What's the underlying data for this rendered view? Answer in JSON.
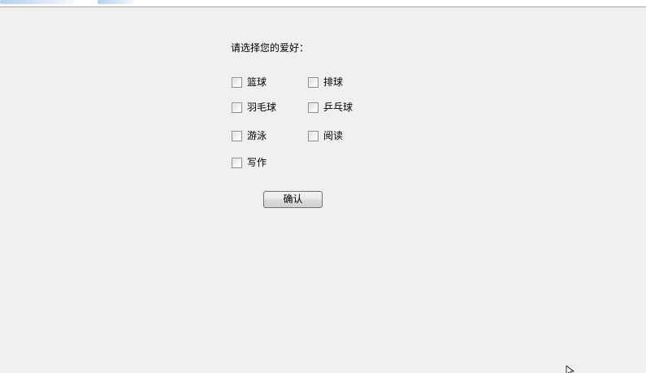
{
  "form": {
    "prompt": "请选择您的爱好：",
    "hobbies": [
      {
        "label": "篮球",
        "checked": false
      },
      {
        "label": "排球",
        "checked": false
      },
      {
        "label": "羽毛球",
        "checked": false
      },
      {
        "label": "乒乓球",
        "checked": false
      },
      {
        "label": "游泳",
        "checked": false
      },
      {
        "label": "阅读",
        "checked": false
      },
      {
        "label": "写作",
        "checked": false
      }
    ],
    "confirm_label": "确认"
  },
  "icons": {
    "checkbox": "checkbox-unchecked-icon",
    "cursor": "mouse-pointer-icon"
  }
}
